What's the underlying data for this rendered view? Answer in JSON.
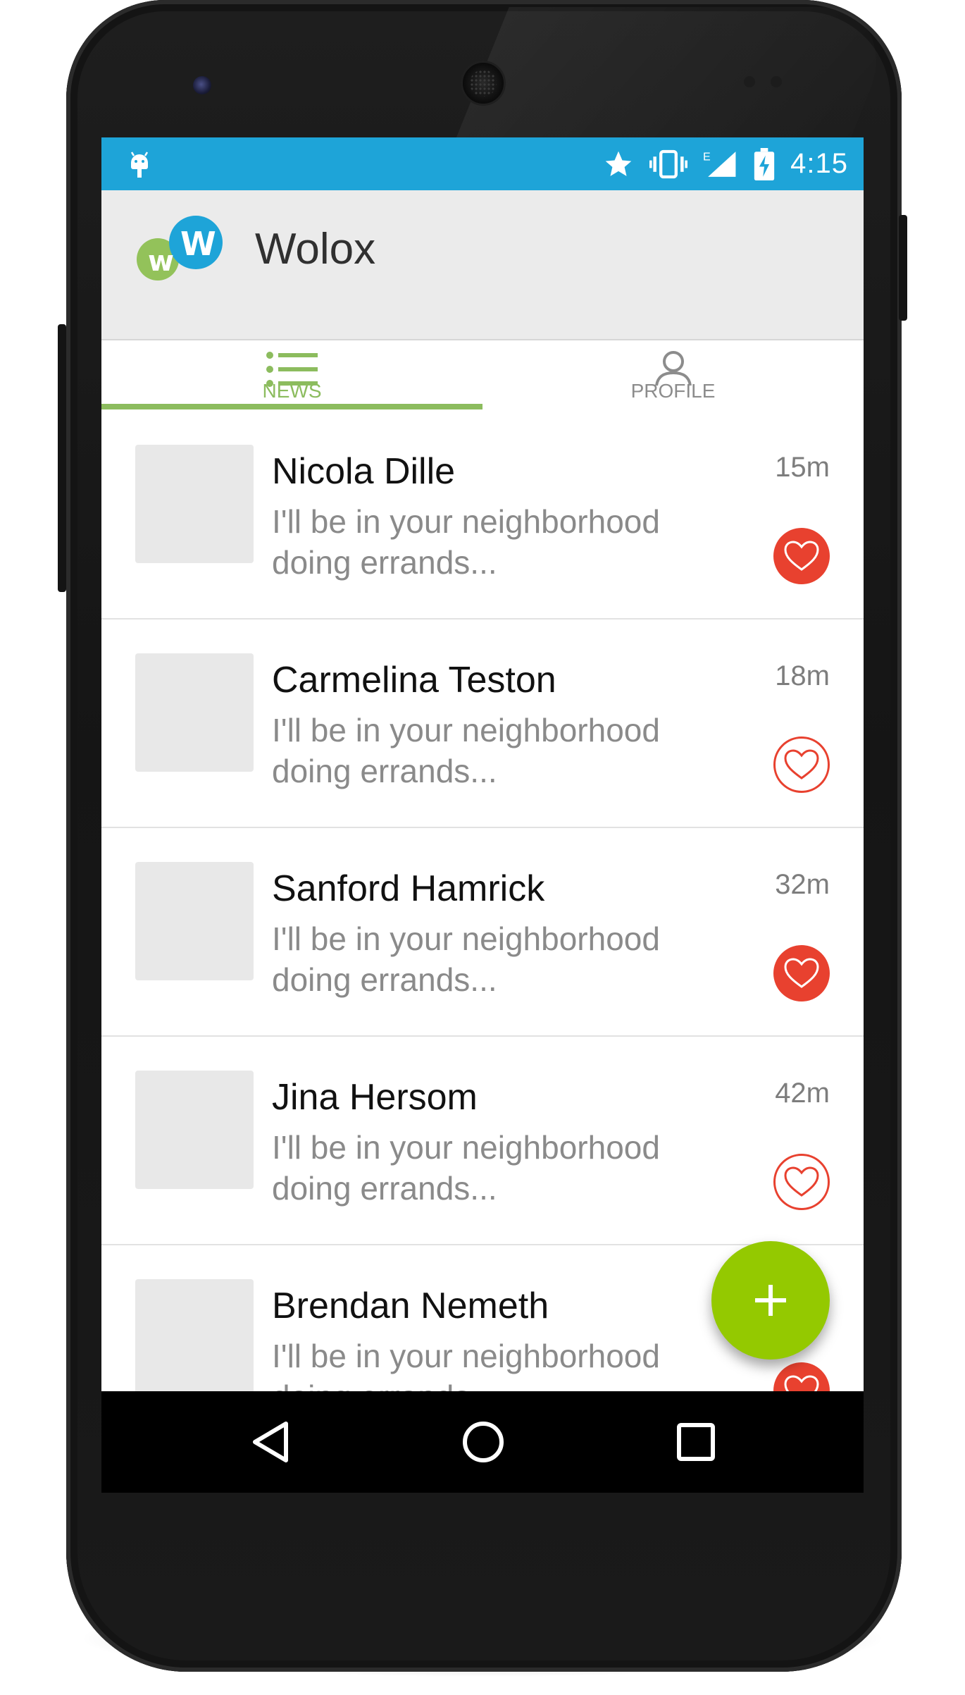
{
  "status_bar": {
    "time": "4:15",
    "icons": [
      "android-icon",
      "star-icon",
      "vibrate-icon",
      "signal-e-icon",
      "battery-charging-icon"
    ]
  },
  "app_bar": {
    "title": "Wolox",
    "logo_letters": [
      "w",
      "W"
    ]
  },
  "tabs": [
    {
      "label": "NEWS",
      "icon": "list-icon",
      "selected": true
    },
    {
      "label": "PROFILE",
      "icon": "person-icon",
      "selected": false
    }
  ],
  "feed": [
    {
      "name": "Nicola Dille",
      "preview_line1": "I'll be in your neighborhood",
      "preview_line2": "doing errands...",
      "time": "15m",
      "liked": true
    },
    {
      "name": "Carmelina Teston",
      "preview_line1": "I'll be in your neighborhood",
      "preview_line2": "doing errands...",
      "time": "18m",
      "liked": false
    },
    {
      "name": "Sanford Hamrick",
      "preview_line1": "I'll be in your neighborhood",
      "preview_line2": "doing errands...",
      "time": "32m",
      "liked": true
    },
    {
      "name": "Jina Hersom",
      "preview_line1": "I'll be in your neighborhood",
      "preview_line2": "doing errands...",
      "time": "42m",
      "liked": false
    },
    {
      "name": "Brendan Nemeth",
      "preview_line1": "I'll be in your neighborhood",
      "preview_line2": "doing errands...",
      "time": "",
      "liked": true
    }
  ],
  "fab": {
    "icon": "plus-icon"
  },
  "nav_bar": {
    "icons": [
      "back-icon",
      "home-icon",
      "recents-icon"
    ]
  },
  "colors": {
    "status_bar": "#1ea4d8",
    "accent_green": "#8cbc5e",
    "fab_green": "#94c900",
    "heart_red": "#e8412f"
  }
}
